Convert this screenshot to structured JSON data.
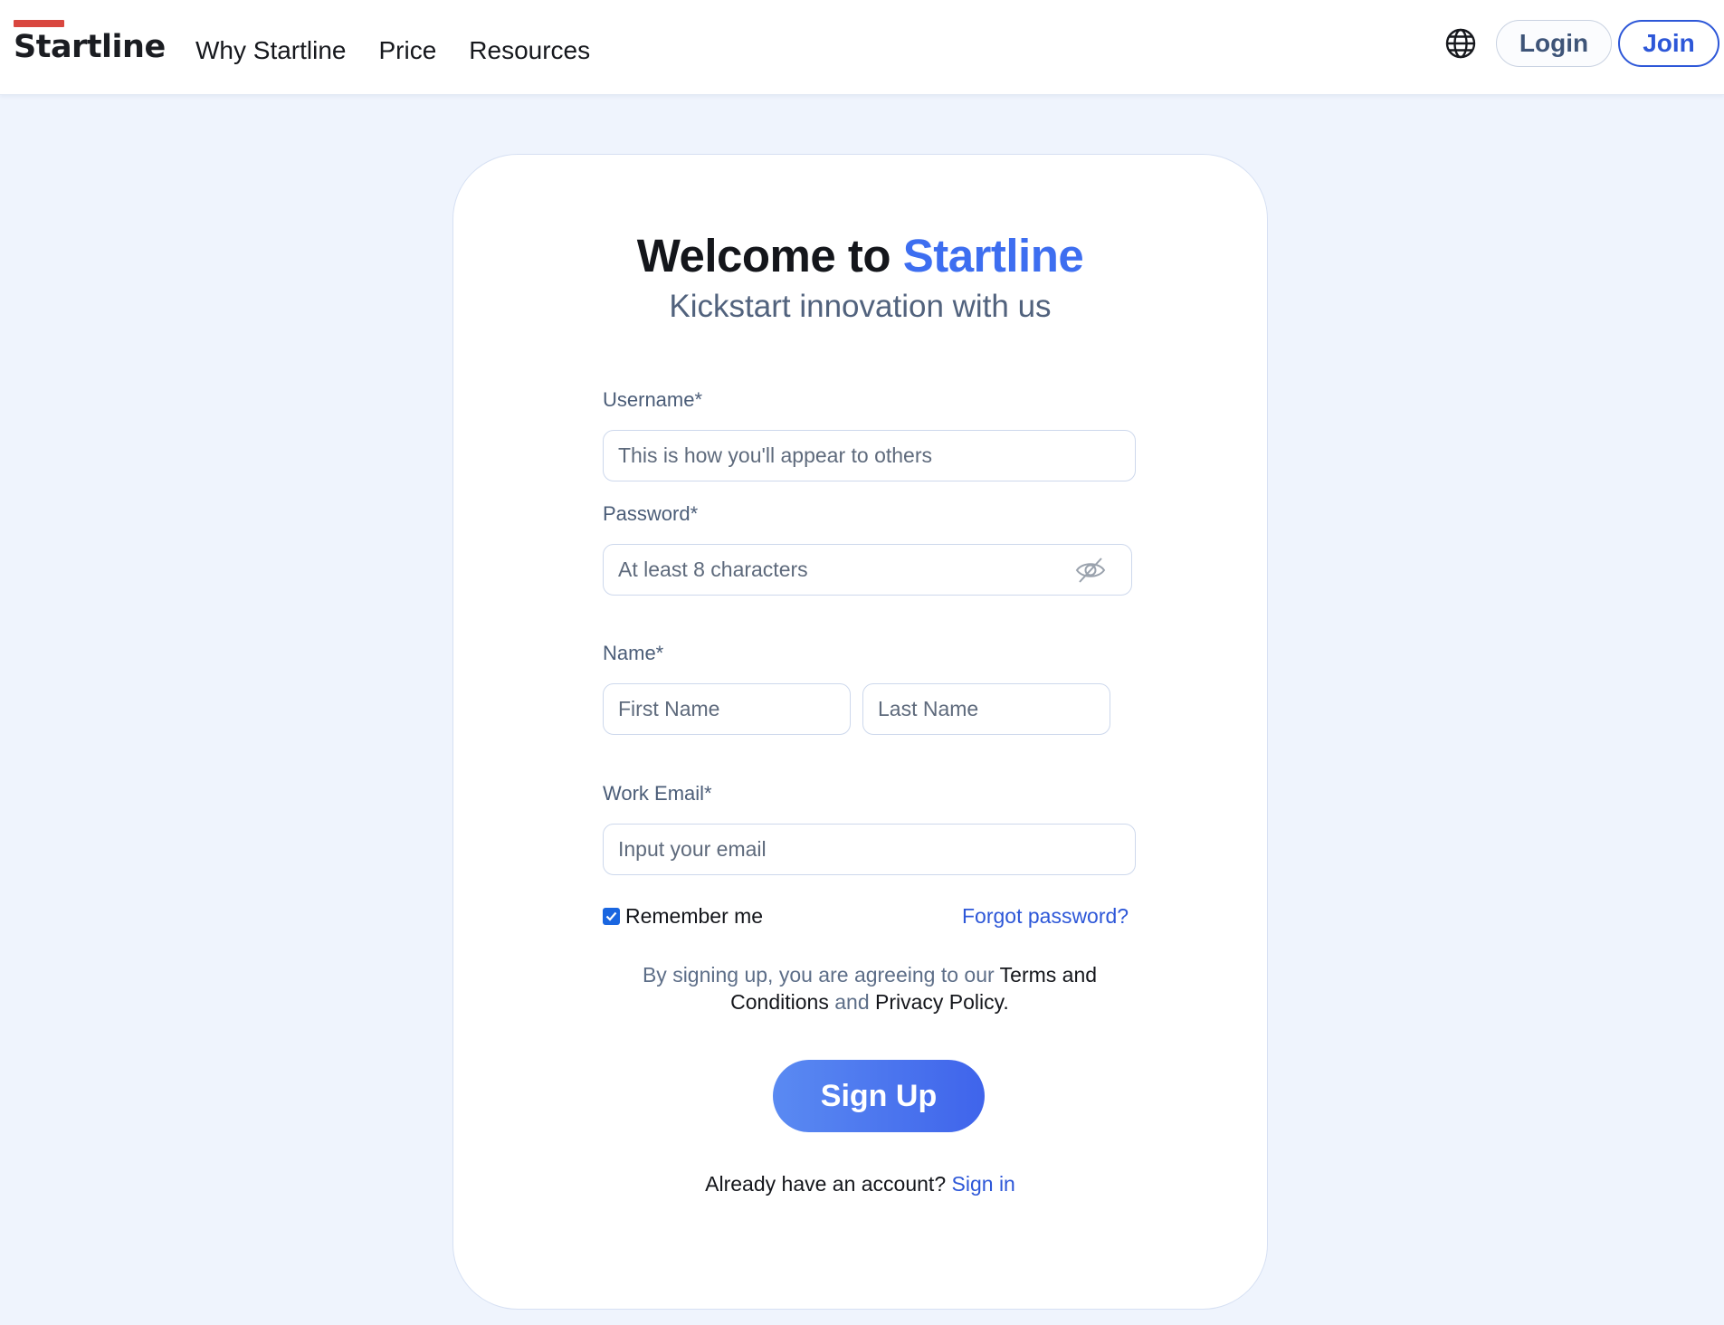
{
  "header": {
    "logo": "Startline",
    "nav": [
      "Why Startline",
      "Price",
      "Resources"
    ],
    "globe_icon": "globe-icon",
    "login_label": "Login",
    "join_label": "Join"
  },
  "form": {
    "title_prefix": "Welcome to ",
    "title_brand": "Startline",
    "subtitle": "Kickstart innovation with us",
    "username": {
      "label": "Username*",
      "placeholder": "This is how you'll appear to others",
      "value": ""
    },
    "password": {
      "label": "Password*",
      "placeholder": "At least 8 characters",
      "value": "",
      "icon": "eye-off-icon"
    },
    "name": {
      "label": "Name*",
      "first_placeholder": "First Name",
      "last_placeholder": "Last Name"
    },
    "email": {
      "label": "Work Email*",
      "placeholder": "Input your email",
      "value": ""
    },
    "remember_label": "Remember me",
    "remember_checked": true,
    "forgot_label": "Forgot password?",
    "terms": {
      "prefix": "By signing up, you are agreeing to our ",
      "terms_link": "Terms and Conditions",
      "and": " and ",
      "privacy_link": "Privacy Policy."
    },
    "signup_label": "Sign Up",
    "already_text": "Already have an account? ",
    "signin_label": "Sign in"
  },
  "colors": {
    "brand_accent": "#3d6ef0",
    "link": "#2d57d8",
    "logo_bar": "#d9473f",
    "background": "#eff4fd"
  }
}
